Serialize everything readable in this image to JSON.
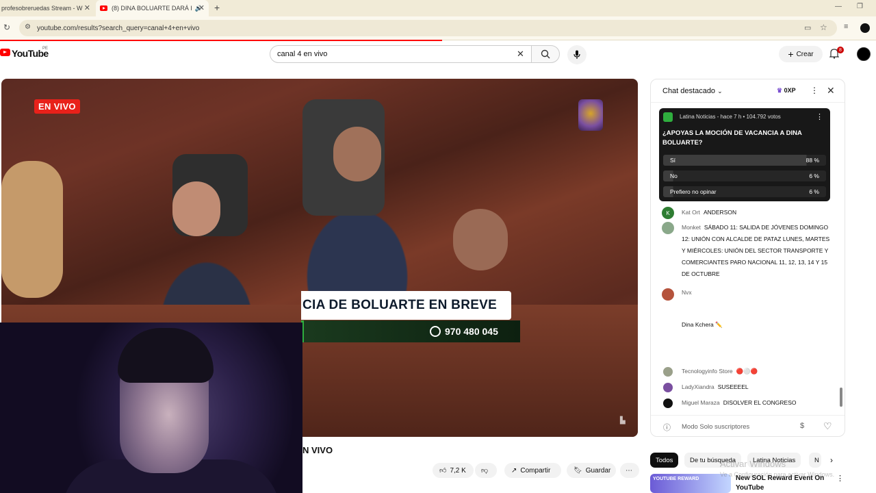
{
  "browser": {
    "tabs": [
      {
        "title": "profesobreruedas Stream - W",
        "active": false
      },
      {
        "title": "(8) DINA BOLUARTE DARÁ I",
        "active": true,
        "audio_icon": "speaker-icon"
      }
    ],
    "url": "youtube.com/results?search_query=canal+4+en+vivo"
  },
  "youtube": {
    "logo_text": "YouTube",
    "region": "PE",
    "search_value": "canal 4 en vivo",
    "create_label": "Crear",
    "notification_count": "8"
  },
  "video": {
    "live_badge": "EN VIVO",
    "lower_third": "CIA DE BOLUARTE EN BREVE",
    "phone": "970 480 045",
    "title_partial": "N VIVO",
    "likes": "7,2 K",
    "share_label": "Compartir",
    "save_label": "Guardar"
  },
  "chat": {
    "header": "Chat destacado",
    "xp": "0XP",
    "poll": {
      "channel": "Latina Noticias",
      "meta": "hace 7 h • 104.792 votos",
      "question": "¿APOYAS LA MOCIÓN DE VACANCIA A DINA BOLUARTE?",
      "options": [
        {
          "label": "Sí",
          "pct": "88 %",
          "value": 88
        },
        {
          "label": "No",
          "pct": "6 %",
          "value": 6
        },
        {
          "label": "Prefiero no opinar",
          "pct": "6 %",
          "value": 6
        }
      ]
    },
    "messages": [
      {
        "author": "Kat Ort",
        "text": "ANDERSON",
        "avatar_color": "#2e7d32",
        "avatar_letter": "K"
      },
      {
        "author": "Monket",
        "text": "SÁBADO 11: SALIDA DE JÓVENES   DOMINGO 12: UNIÓN CON ALCALDE DE PATAZ   LUNES, MARTES Y MIÉRCOLES: UNIÓN DEL SECTOR TRANSPORTE Y COMERCIANTES   PARO NACIONAL 11, 12, 13, 14 Y 15 DE OCTUBRE",
        "avatar_color": "#8aa88a"
      },
      {
        "author": "Nvx",
        "text": "",
        "avatar_color": "#b5533c"
      },
      {
        "author": "",
        "text": "Dina Kchera ✏️",
        "avatar_color": ""
      },
      {
        "author": "Tecnologyinfo Store",
        "text": "🔴⚪🔴",
        "avatar_color": "#9aa08a"
      },
      {
        "author": "LadyXiandra",
        "text": "SUSEEEEL",
        "avatar_color": "#7a4fa0"
      },
      {
        "author": "Miguel Maraza",
        "text": "DISOLVER EL CONGRESO",
        "avatar_color": "#111111"
      }
    ],
    "footer": "Modo Solo suscriptores"
  },
  "chips": [
    "Todos",
    "De tu búsqueda",
    "Latina Noticias",
    "N"
  ],
  "recommendation": {
    "thumb_text": "YOUTUBE REWARD",
    "title": "New SOL Reward Event On YouTube"
  },
  "watermark": {
    "line1": "Activar Windows",
    "line2": "Ve a Configuración para activar Windows."
  },
  "colors": {
    "accent": "#ff0000",
    "live_badge": "#e8211a",
    "whatsapp": "#2fae3e"
  }
}
